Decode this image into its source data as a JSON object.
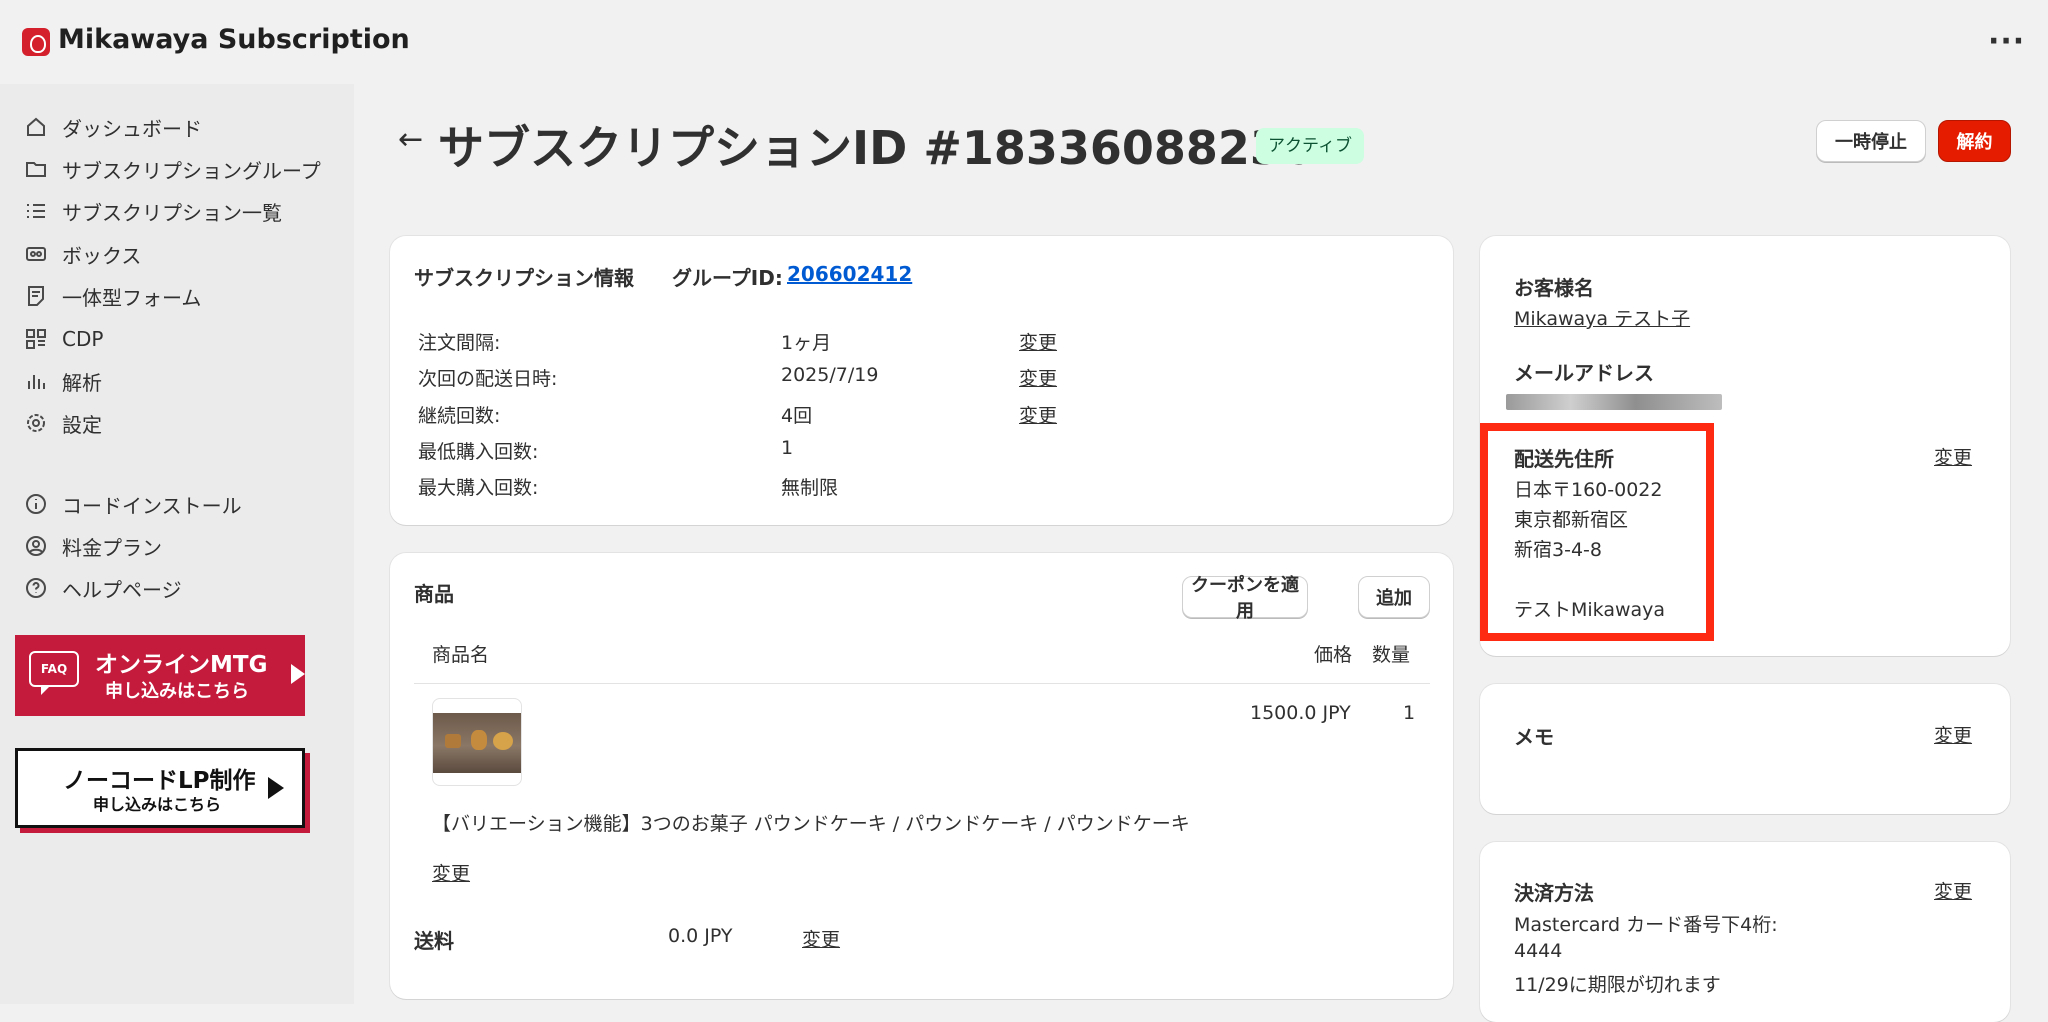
{
  "app": {
    "title": "Mikawaya Subscription",
    "more_label": "···"
  },
  "sidebar": {
    "items": [
      {
        "label": "ダッシュボード",
        "icon": "home-icon"
      },
      {
        "label": "サブスクリプショングループ",
        "icon": "folder-icon"
      },
      {
        "label": "サブスクリプション一覧",
        "icon": "list-icon"
      },
      {
        "label": "ボックス",
        "icon": "box-icon"
      },
      {
        "label": "一体型フォーム",
        "icon": "form-icon"
      },
      {
        "label": "CDP",
        "icon": "grid-icon"
      },
      {
        "label": "解析",
        "icon": "chart-icon"
      },
      {
        "label": "設定",
        "icon": "gear-icon"
      }
    ],
    "items2": [
      {
        "label": "コードインストール",
        "icon": "info-icon"
      },
      {
        "label": "料金プラン",
        "icon": "user-circle-icon"
      },
      {
        "label": "ヘルプページ",
        "icon": "help-icon"
      }
    ],
    "banner_mtg": {
      "faq": "FAQ",
      "line1": "オンラインMTG",
      "line2": "申し込みはこちら"
    },
    "banner_lp": {
      "line1": "ノーコードLP制作",
      "line2": "申し込みはこちら"
    }
  },
  "header": {
    "back": "←",
    "title": "サブスクリプションID #18336088236",
    "status": "アクティブ",
    "pause_label": "一時停止",
    "cancel_label": "解約"
  },
  "info": {
    "heading": "サブスクリプション情報",
    "group_label": "グループID:",
    "group_id": "206602412",
    "rows": [
      {
        "label": "注文間隔:",
        "value": "1ヶ月",
        "action": "変更"
      },
      {
        "label": "次回の配送日時:",
        "value": "2025/7/19",
        "action": "変更"
      },
      {
        "label": "継続回数:",
        "value": "4回",
        "action": "変更"
      },
      {
        "label": "最低購入回数:",
        "value": "1"
      },
      {
        "label": "最大購入回数:",
        "value": "無制限"
      }
    ]
  },
  "products": {
    "heading": "商品",
    "coupon_label": "クーポンを適用",
    "add_label": "追加",
    "col_name": "商品名",
    "col_price": "価格",
    "col_qty": "数量",
    "item": {
      "price": "1500.0 JPY",
      "qty": "1",
      "name": "【バリエーション機能】3つのお菓子 パウンドケーキ / パウンドケーキ / パウンドケーキ",
      "change": "変更"
    },
    "shipping_label": "送料",
    "shipping_value": "0.0 JPY",
    "shipping_change": "変更"
  },
  "customer": {
    "name_heading": "お客様名",
    "name": "Mikawaya テスト子",
    "email_heading": "メールアドレス",
    "address_heading": "配送先住所",
    "address_change": "変更",
    "address_lines": [
      "日本〒160-0022",
      "東京都新宿区",
      "新宿3-4-8",
      "",
      "テストMikawaya"
    ]
  },
  "memo": {
    "heading": "メモ",
    "change": "変更"
  },
  "payment": {
    "heading": "決済方法",
    "change": "変更",
    "card_line": "Mastercard  カード番号下4桁:",
    "last4": "4444",
    "expiry": "11/29に期限が切れます"
  },
  "colors": {
    "accent_link": "#005bd3",
    "danger": "#e51c00",
    "badge_bg": "#cdfee1",
    "highlight": "#ff2a12",
    "banner": "#c41a3b"
  }
}
